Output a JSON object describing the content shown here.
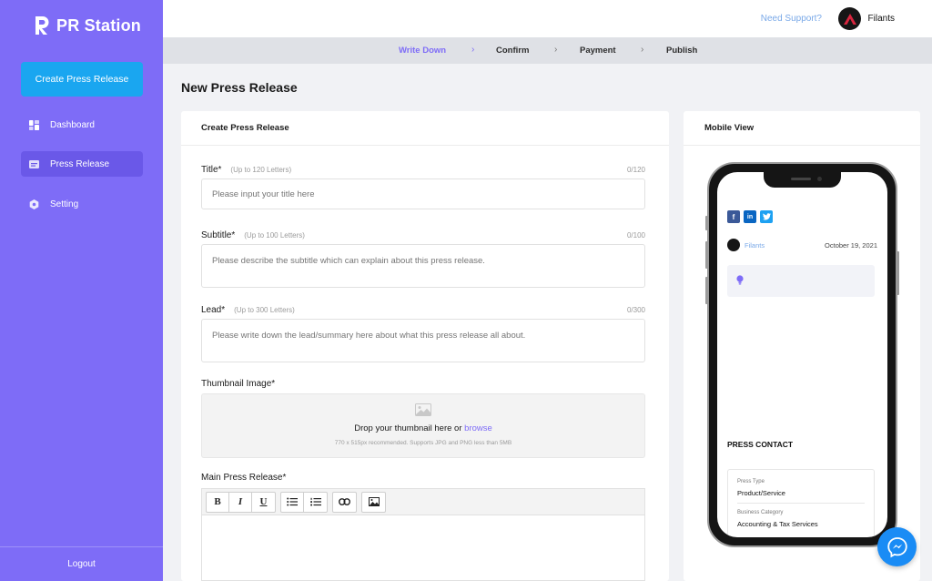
{
  "brand": {
    "name": "PR Station"
  },
  "sidebar": {
    "create_button": "Create Press Release",
    "items": [
      {
        "label": "Dashboard",
        "icon": "dashboard-icon"
      },
      {
        "label": "Press Release",
        "icon": "document-icon",
        "active": true
      },
      {
        "label": "Setting",
        "icon": "gear-icon"
      }
    ],
    "logout": "Logout"
  },
  "topbar": {
    "support": "Need Support?",
    "user_name": "Filants"
  },
  "steps": [
    {
      "label": "Write Down",
      "active": true
    },
    {
      "label": "Confirm"
    },
    {
      "label": "Payment"
    },
    {
      "label": "Publish"
    }
  ],
  "page_title": "New Press Release",
  "form": {
    "card_title": "Create Press Release",
    "title": {
      "label": "Title*",
      "hint": "(Up to 120 Letters)",
      "count": "0/120",
      "placeholder": "Please input your title here"
    },
    "subtitle": {
      "label": "Subtitle*",
      "hint": "(Up to 100 Letters)",
      "count": "0/100",
      "placeholder": "Please describe the subtitle which can explain about this press release."
    },
    "lead": {
      "label": "Lead*",
      "hint": "(Up to 300 Letters)",
      "count": "0/300",
      "placeholder": "Please write down the lead/summary here about what this press release all about."
    },
    "thumbnail": {
      "label": "Thumbnail Image*",
      "drop_text": "Drop your thumbnail here or",
      "browse": "browse",
      "note": "770 x 515px recommended. Supports JPG and PNG less than 5MB"
    },
    "main": {
      "label": "Main Press Release*"
    },
    "toolbar": {
      "bold": "B",
      "italic": "I",
      "underline": "U"
    }
  },
  "mobile": {
    "card_title": "Mobile View",
    "author": "Filants",
    "date": "October 19, 2021",
    "press_contact": "PRESS CONTACT",
    "contact": [
      {
        "label": "Press Type",
        "value": "Product/Service"
      },
      {
        "label": "Business Category",
        "value": "Accounting & Tax Services"
      }
    ],
    "social": {
      "facebook": "f",
      "linkedin": "in",
      "twitter": "twitter-icon"
    }
  },
  "colors": {
    "sidebar": "#7e6cf7",
    "sidebar_active": "#6a58e8",
    "create_button": "#1aa6f0",
    "accent": "#7e6cf7",
    "messenger": "#1a8cf5",
    "facebook": "#3b5998",
    "linkedin": "#0a66c2",
    "twitter": "#1da1f2"
  }
}
